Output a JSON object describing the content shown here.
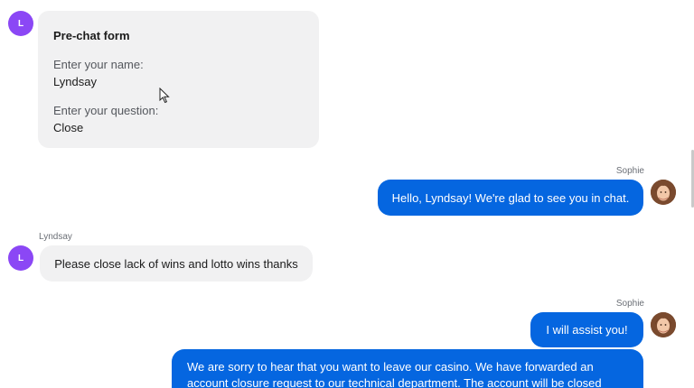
{
  "prechat": {
    "avatar_initial": "L",
    "title": "Pre-chat form",
    "name_label": "Enter your name:",
    "name_value": "Lyndsay",
    "question_label": "Enter your question:",
    "question_value": "Close"
  },
  "messages": [
    {
      "sender": "Sophie",
      "text": "Hello, Lyndsay! We're glad to see you in chat."
    },
    {
      "sender": "Lyndsay",
      "avatar_initial": "L",
      "text": "Please close lack of wins and lotto wins thanks"
    },
    {
      "sender": "Sophie",
      "text": "I will assist you!"
    },
    {
      "sender": "Sophie",
      "text": "We are sorry to hear that you want to leave our casino. We have forwarded an account closure request to our technical department. The account will be closed"
    }
  ],
  "colors": {
    "agent_bubble": "#0566e0",
    "user_bubble": "#f1f1f2",
    "user_avatar": "#8b47f5"
  }
}
